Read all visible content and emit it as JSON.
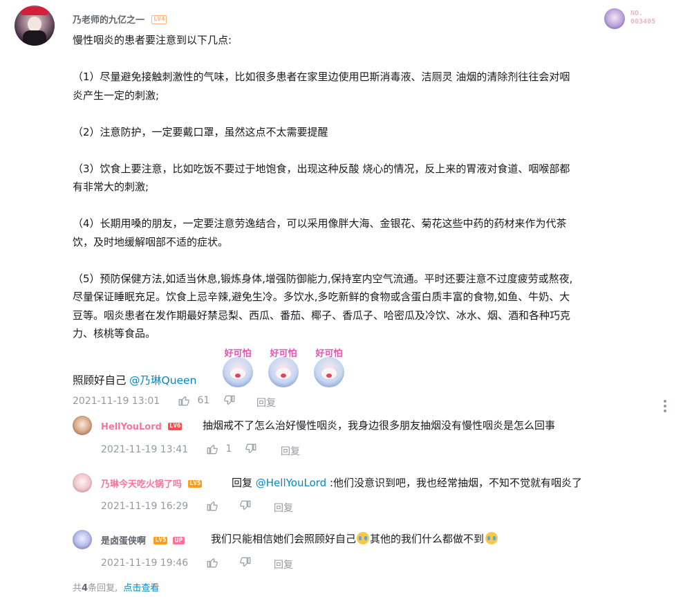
{
  "comment": {
    "username": "乃老师的九亿之一",
    "level": "LV4",
    "badge_no_label": "NO.",
    "badge_no_value": "003405",
    "content_lines": [
      "慢性咽炎的患者要注意到以下几点:",
      "",
      "（1）尽量避免接触刺激性的气味，比如很多患者在家里边使用巴斯消毒液、洁厕灵 油烟的清除剂往往会对咽",
      "炎产生一定的刺激;",
      "",
      "（2）注意防护，一定要戴口罩，虽然这点不太需要提醒",
      "",
      "（3）饮食上要注意，比如吃饭不要过于地饱食，出现这种反酸 烧心的情况，反上来的胃液对食道、咽喉部都",
      "有非常大的刺激;",
      "",
      "（4）长期用嗓的朋友，一定要注意劳逸结合，可以采用像胖大海、金银花、菊花这些中药的药材来作为代茶",
      "饮，及时地缓解咽部不适的症状。",
      "",
      "（5）预防保健方法,如适当休息,锻炼身体,增强防御能力,保持室内空气流通。平时还要注意不过度疲劳或熬夜,",
      "尽量保证睡眠充足。饮食上忌辛辣,避免生冷。多饮水,多吃新鲜的食物或含蛋白质丰富的食物,如鱼、牛奶、大",
      "豆等。咽炎患者在发作期最好禁忌梨、西瓜、番茄、椰子、香瓜子、哈密瓜及冷饮、冰水、烟、酒和各种巧克",
      "力、核桃等食品。"
    ],
    "last_line_prefix": "照顾好自己",
    "mention": "@乃琳Queen",
    "emote_label": "好可怕",
    "time": "2021-11-19 13:01",
    "likes": "61",
    "reply_label": "回复",
    "more_icon": "more-vertical-icon"
  },
  "replies": [
    {
      "username": "HellYouLord",
      "level": "LV6",
      "level_color": "#ff6c00",
      "name_color": "#fb7299",
      "text": "抽烟戒不了怎么治好慢性咽炎，我身边很多朋友抽烟没有慢性咽炎是怎么回事",
      "time": "2021-11-19 13:41",
      "likes": "1",
      "reply_label": "回复"
    },
    {
      "username": "乃琳今天吃火锅了吗",
      "level": "LV5",
      "level_color": "#ff6c00",
      "name_color": "#fb7299",
      "reply_prefix": "回复 ",
      "mention": "@HellYouLord",
      "text": " :他们没意识到吧，我也经常抽烟，不知不觉就有咽炎了",
      "time": "2021-11-19 16:29",
      "reply_label": "回复"
    },
    {
      "username": "是卤蛋侠啊",
      "level": "LV5",
      "level_color": "#ff6c00",
      "up_badge": "UP",
      "name_color": "#61666d",
      "text_a": "我们只能相信她们会照顾好自己",
      "text_b": "其他的我们什么都做不到",
      "time": "2021-11-19 19:46",
      "reply_label": "回复"
    }
  ],
  "footer": {
    "total_prefix": "共",
    "total_count": "4",
    "total_suffix": "条回复,",
    "view_link": "点击查看"
  },
  "colors": {
    "link": "#008ac5",
    "meta": "#9499a0",
    "pink": "#fb7299"
  }
}
